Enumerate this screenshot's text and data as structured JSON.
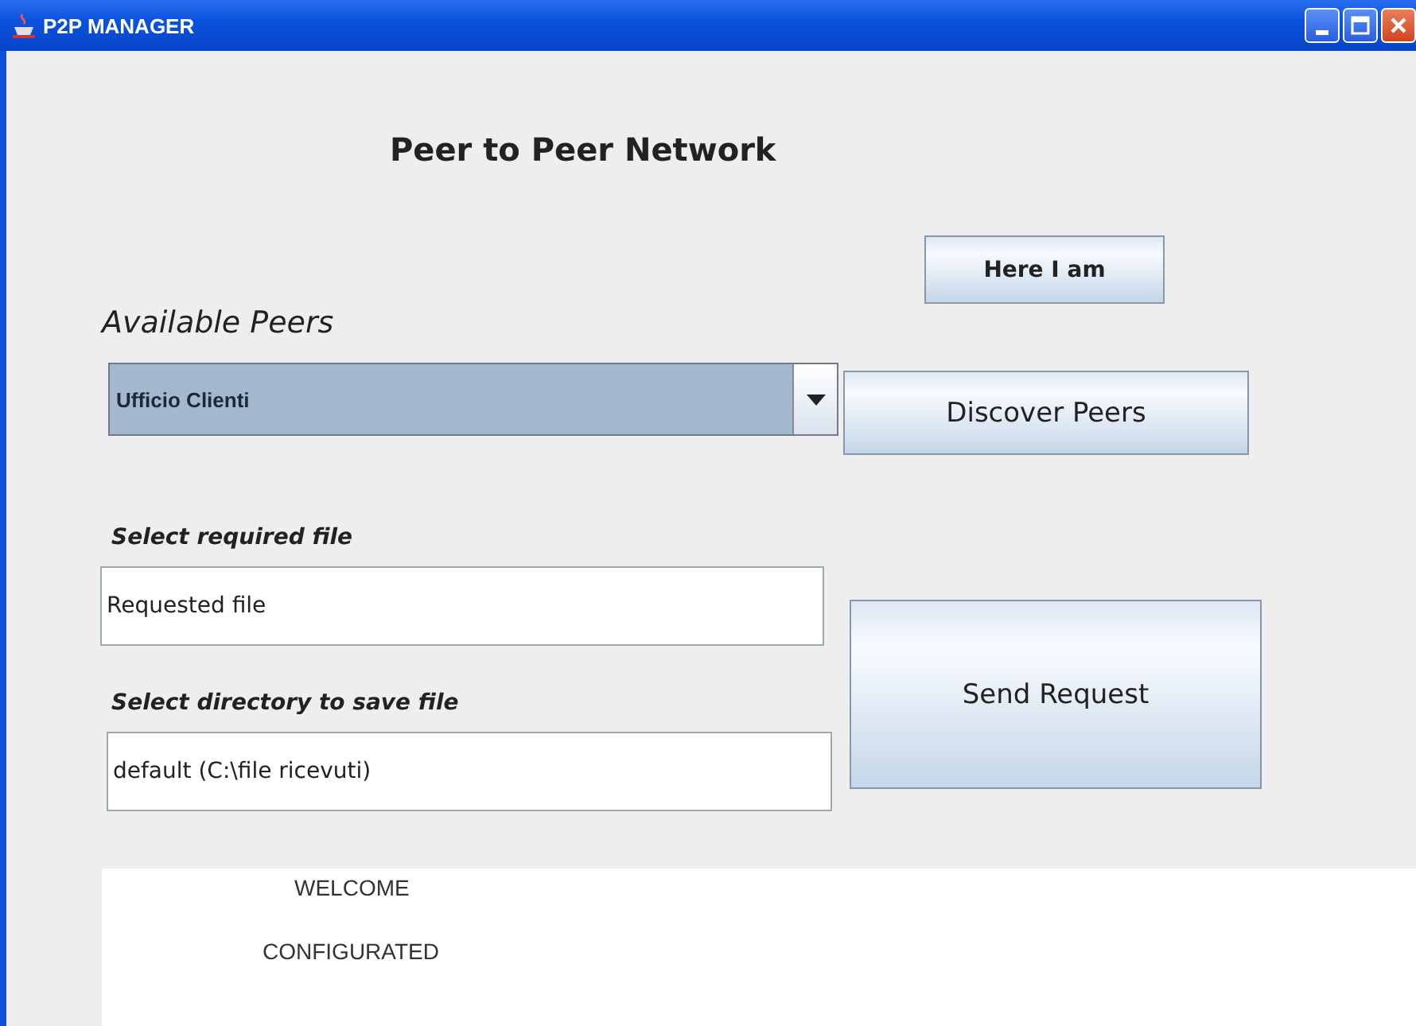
{
  "window": {
    "title": "P2P MANAGER"
  },
  "heading": "Peer to Peer Network",
  "peers": {
    "label": "Available Peers",
    "value": "Ufficio Clienti"
  },
  "file_field": {
    "label": "Select required file",
    "value": "Requested file"
  },
  "dir_field": {
    "label": "Select directory to save file",
    "value": "default (C:\\file ricevuti)"
  },
  "buttons": {
    "here": "Here I am",
    "discover": "Discover Peers",
    "send": "Send Request"
  },
  "log": [
    "WELCOME",
    "CONFIGURATED"
  ]
}
